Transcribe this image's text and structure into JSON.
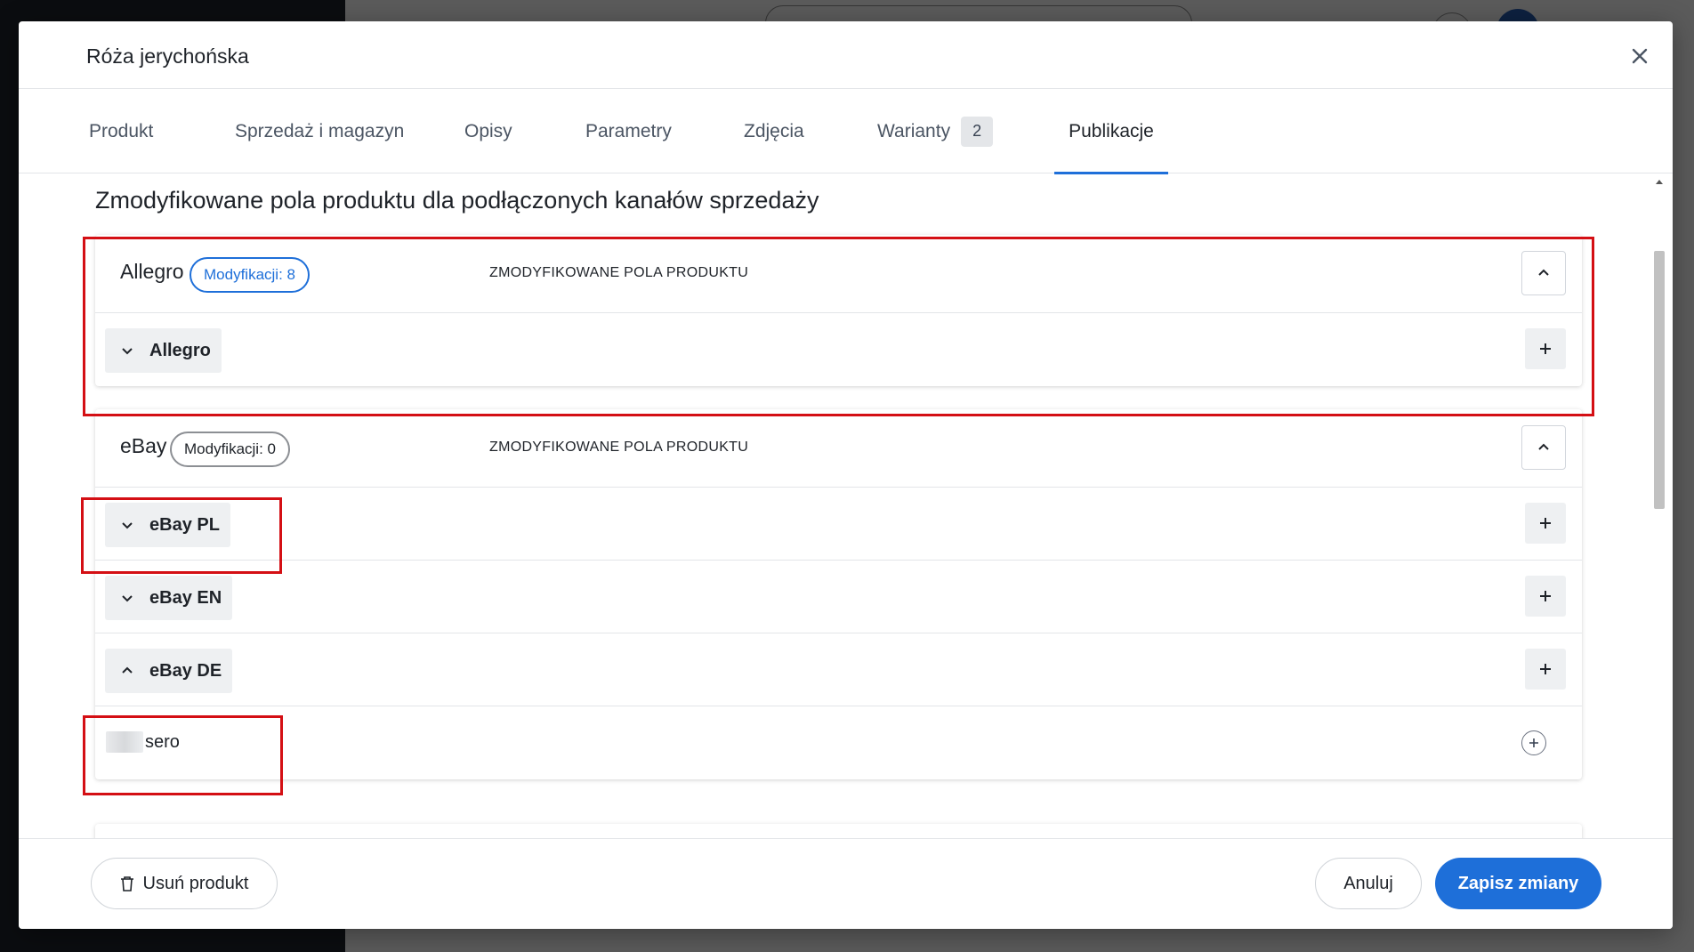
{
  "modal": {
    "title": "Róża jerychońska",
    "close_label": "×"
  },
  "tabs": [
    {
      "label": "Produkt"
    },
    {
      "label": "Sprzedaż i magazyn"
    },
    {
      "label": "Opisy"
    },
    {
      "label": "Parametry"
    },
    {
      "label": "Zdjęcia"
    },
    {
      "label": "Warianty",
      "badge": "2"
    },
    {
      "label": "Publikacje",
      "active": true
    }
  ],
  "section": {
    "title": "Zmodyfikowane pola produktu dla podłączonych kanałów sprzedaży"
  },
  "channels": [
    {
      "name": "Allegro",
      "badge": "Modyfikacji: 8",
      "head_label": "ZMODYFIKOWANE POLA PRODUKTU",
      "rows": [
        {
          "label": "Allegro",
          "chevron": "down"
        }
      ]
    },
    {
      "name": "eBay",
      "badge": "Modyfikacji: 0",
      "head_label": "ZMODYFIKOWANE POLA PRODUKTU",
      "rows": [
        {
          "label": "eBay PL",
          "chevron": "down"
        },
        {
          "label": "eBay EN",
          "chevron": "down"
        },
        {
          "label": "eBay DE",
          "chevron": "up"
        }
      ],
      "account_row": {
        "text": "sero"
      }
    }
  ],
  "footer": {
    "delete_label": "Usuń produkt",
    "cancel_label": "Anuluj",
    "save_label": "Zapisz zmiany"
  },
  "colors": {
    "accent": "#1e6fd9",
    "annotation": "#d40f14"
  },
  "icons": [
    "close-icon",
    "chevron-up-icon",
    "chevron-down-icon",
    "plus-icon",
    "plus-circle-icon",
    "trash-icon"
  ]
}
